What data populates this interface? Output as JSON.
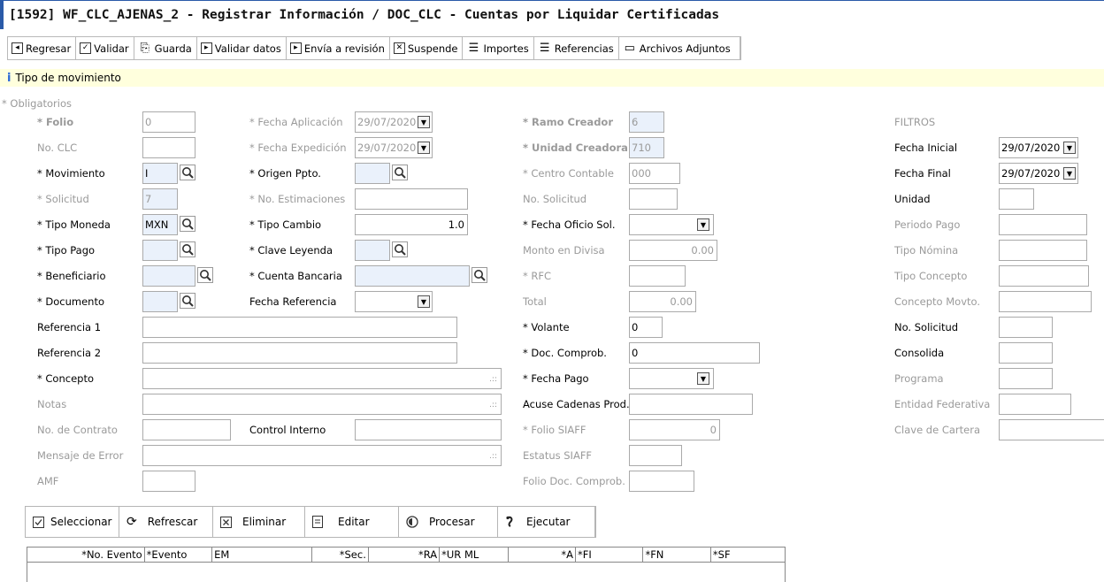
{
  "window": {
    "title": "[1592]  WF_CLC_AJENAS_2 - Registrar Información / DOC_CLC - Cuentas por Liquidar Certificadas"
  },
  "toolbar": {
    "regresar": "Regresar",
    "validar": "Validar",
    "guarda": "Guarda",
    "validar_datos": "Validar datos",
    "envia_revision": "Envía a revisión",
    "suspende": "Suspende",
    "importes": "Importes",
    "referencias": "Referencias",
    "archivos_adjuntos": "Archivos Adjuntos"
  },
  "infobar": {
    "text": "Tipo de movimiento"
  },
  "form": {
    "obligatorios": "* Obligatorios",
    "col1": {
      "folio_label": "* Folio",
      "folio_value": "0",
      "no_clc_label": "No. CLC",
      "no_clc_value": "",
      "movimiento_label": "* Movimiento",
      "movimiento_value": "I",
      "solicitud_label": "* Solicitud",
      "solicitud_value": "7",
      "tipo_moneda_label": "* Tipo Moneda",
      "tipo_moneda_value": "MXN",
      "tipo_pago_label": "* Tipo Pago",
      "tipo_pago_value": "",
      "beneficiario_label": "* Beneficiario",
      "beneficiario_value": "",
      "documento_label": "* Documento",
      "documento_value": "",
      "referencia1_label": "Referencia 1",
      "referencia1_value": "",
      "referencia2_label": "Referencia 2",
      "referencia2_value": "",
      "concepto_label": "* Concepto",
      "concepto_value": "",
      "notas_label": "Notas",
      "notas_value": "",
      "no_contrato_label": "No. de Contrato",
      "no_contrato_value": "",
      "mensaje_error_label": "Mensaje de Error",
      "mensaje_error_value": "",
      "amf_label": "AMF",
      "amf_value": ""
    },
    "col2": {
      "fecha_aplicacion_label": "* Fecha Aplicación",
      "fecha_aplicacion_value": "29/07/2020",
      "fecha_expedicion_label": "* Fecha Expedición",
      "fecha_expedicion_value": "29/07/2020",
      "origen_ppto_label": "* Origen Ppto.",
      "origen_ppto_value": "",
      "no_estimaciones_label": "* No. Estimaciones",
      "no_estimaciones_value": "",
      "tipo_cambio_label": "* Tipo Cambio",
      "tipo_cambio_value": "1.0",
      "clave_leyenda_label": "* Clave Leyenda",
      "clave_leyenda_value": "",
      "cuenta_bancaria_label": "* Cuenta Bancaria",
      "cuenta_bancaria_value": "",
      "fecha_referencia_label": "Fecha Referencia",
      "fecha_referencia_value": "",
      "control_interno_label": "Control Interno",
      "control_interno_value": ""
    },
    "col3": {
      "ramo_creador_label": "* Ramo Creador",
      "ramo_creador_value": "6",
      "unidad_creadora_label": "* Unidad Creadora",
      "unidad_creadora_value": "710",
      "centro_contable_label": "* Centro Contable",
      "centro_contable_value": "000",
      "no_solicitud_label": "No. Solicitud",
      "no_solicitud_value": "",
      "fecha_oficio_label": "* Fecha Oficio Sol.",
      "fecha_oficio_value": "",
      "monto_divisa_label": "Monto en Divisa",
      "monto_divisa_value": "0.00",
      "rfc_label": "* RFC",
      "rfc_value": "",
      "total_label": "Total",
      "total_value": "0.00",
      "volante_label": "* Volante",
      "volante_value": "0",
      "doc_comprob_label": "* Doc. Comprob.",
      "doc_comprob_value": "0",
      "fecha_pago_label": "* Fecha  Pago",
      "fecha_pago_value": "",
      "acuse_label": "Acuse Cadenas Prod.",
      "acuse_value": "",
      "folio_siaff_label": "* Folio SIAFF",
      "folio_siaff_value": "0",
      "estatus_siaff_label": "Estatus SIAFF",
      "estatus_siaff_value": "",
      "folio_doc_label": "Folio Doc. Comprob.",
      "folio_doc_value": ""
    },
    "filtros": {
      "title": "FILTROS",
      "fecha_inicial_label": "Fecha Inicial",
      "fecha_inicial_value": "29/07/2020",
      "fecha_final_label": "Fecha Final",
      "fecha_final_value": "29/07/2020",
      "unidad_label": "Unidad",
      "unidad_value": "",
      "periodo_pago_label": "Periodo Pago",
      "periodo_pago_value": "",
      "tipo_nomina_label": "Tipo Nómina",
      "tipo_nomina_value": "",
      "tipo_concepto_label": "Tipo Concepto",
      "tipo_concepto_value": "",
      "concepto_movto_label": "Concepto Movto.",
      "concepto_movto_value": "",
      "no_solicitud_label": "No. Solicitud",
      "no_solicitud_value": "",
      "consolida_label": "Consolida",
      "consolida_value": "",
      "programa_label": "Programa",
      "programa_value": "",
      "entidad_label": "Entidad Federativa",
      "entidad_value": "",
      "clave_cartera_label": "Clave de Cartera",
      "clave_cartera_value": ""
    }
  },
  "actions": {
    "seleccionar": "Seleccionar",
    "refrescar": "Refrescar",
    "eliminar": "Eliminar",
    "editar": "Editar",
    "procesar": "Procesar",
    "ejecutar": "Ejecutar"
  },
  "grid": {
    "columns": [
      "*No. Evento",
      "*Evento",
      "EM",
      "*Sec.",
      "*RA",
      "*UR ML",
      "*A",
      "*FI",
      "*FN",
      "*SF"
    ]
  }
}
